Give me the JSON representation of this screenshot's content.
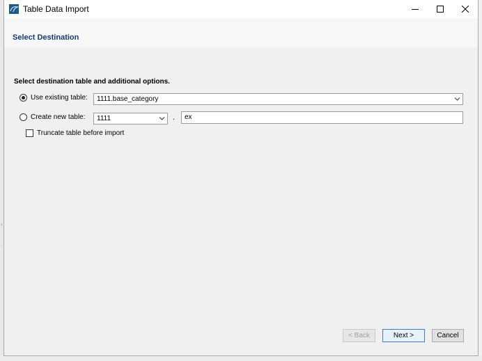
{
  "window": {
    "title": "Table Data Import",
    "controls": {
      "minimize": "minimize",
      "maximize": "maximize",
      "close": "close"
    }
  },
  "header": {
    "title": "Select Destination"
  },
  "main": {
    "instruction": "Select destination table and additional options.",
    "use_existing": {
      "label": "Use existing table:",
      "selected": true,
      "value": "1111.base_category"
    },
    "create_new": {
      "label": "Create new table:",
      "selected": false,
      "schema_value": "1111",
      "separator": ".",
      "table_name": "ex"
    },
    "truncate": {
      "label": "Truncate table before import",
      "checked": false
    }
  },
  "footer": {
    "back_label": "< Back",
    "next_label": "Next >",
    "cancel_label": "Cancel"
  },
  "icons": {
    "app": "mysql-workbench-icon",
    "combo_arrow": "chevron-down-icon"
  },
  "colors": {
    "header_title": "#123d7b",
    "app_icon": "#1f5a8c",
    "default_button_border": "#3b7bd6"
  }
}
